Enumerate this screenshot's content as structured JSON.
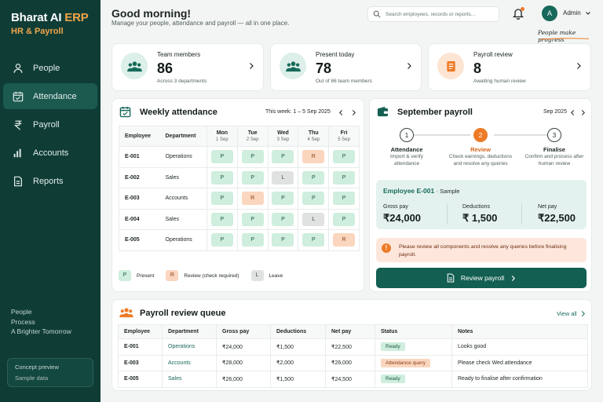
{
  "brand": {
    "title": "Bharat AI",
    "title_accent": "ERP",
    "subtitle": "HR & Payroll"
  },
  "nav": [
    {
      "label": "People",
      "icon": "person-icon",
      "active": false
    },
    {
      "label": "Attendance",
      "icon": "calendar-icon",
      "active": true
    },
    {
      "label": "Payroll",
      "icon": "rupee-icon",
      "active": false
    },
    {
      "label": "Accounts",
      "icon": "bar-chart-icon",
      "active": false
    },
    {
      "label": "Reports",
      "icon": "document-icon",
      "active": false
    }
  ],
  "tagline": [
    "People",
    "Process",
    "A Brighter Tomorrow"
  ],
  "concept": {
    "title": "Concept preview",
    "sub": "Sample data"
  },
  "header": {
    "greeting": "Good morning!",
    "subtitle": "Manage your people, attendance and payroll — all in one place.",
    "search_placeholder": "Search employees, records or reports...",
    "avatar_initial": "A",
    "user": "Admin",
    "slogan": "People make progress"
  },
  "stats": [
    {
      "label": "Team members",
      "value": "86",
      "sub": "Across 3 departments",
      "icon": "team-icon"
    },
    {
      "label": "Present today",
      "value": "78",
      "sub": "Out of 86 team members",
      "icon": "team-icon"
    },
    {
      "label": "Payroll review",
      "value": "8",
      "sub": "Awaiting human review",
      "icon": "document-icon"
    }
  ],
  "attendance": {
    "title": "Weekly attendance",
    "week": "This week: 1 – 5 Sep 2025",
    "col_employee": "Employee",
    "col_department": "Department",
    "days": [
      {
        "d": "Mon",
        "date": "1 Sep"
      },
      {
        "d": "Tue",
        "date": "2 Sep"
      },
      {
        "d": "Wed",
        "date": "3 Sep"
      },
      {
        "d": "Thu",
        "date": "4 Sep"
      },
      {
        "d": "Fri",
        "date": "5 Sep"
      }
    ],
    "rows": [
      {
        "emp": "E-001",
        "dept": "Operations",
        "marks": [
          "P",
          "P",
          "P",
          "R",
          "P"
        ]
      },
      {
        "emp": "E-002",
        "dept": "Sales",
        "marks": [
          "P",
          "P",
          "L",
          "P",
          "P"
        ]
      },
      {
        "emp": "E-003",
        "dept": "Accounts",
        "marks": [
          "P",
          "R",
          "P",
          "P",
          "P"
        ]
      },
      {
        "emp": "E-004",
        "dept": "Sales",
        "marks": [
          "P",
          "P",
          "P",
          "L",
          "P"
        ]
      },
      {
        "emp": "E-005",
        "dept": "Operations",
        "marks": [
          "P",
          "P",
          "P",
          "P",
          "R"
        ]
      }
    ],
    "legend": [
      {
        "code": "P",
        "label": "Present"
      },
      {
        "code": "R",
        "label": "Review (check required)"
      },
      {
        "code": "L",
        "label": "Leave"
      }
    ]
  },
  "payroll": {
    "title": "September payroll",
    "month": "Sep 2025",
    "steps": [
      {
        "n": "1",
        "title": "Attendance",
        "desc": "Import & verify attendance",
        "current": false
      },
      {
        "n": "2",
        "title": "Review",
        "desc": "Check earnings, deductions and resolve any queries",
        "current": true
      },
      {
        "n": "3",
        "title": "Finalise",
        "desc": "Confirm and process after human review",
        "current": false
      }
    ],
    "employee": "Employee E-001",
    "employee_tag": "· Sample",
    "gross_label": "Gross pay",
    "gross": "₹24,000",
    "ded_label": "Deductions",
    "ded": "₹ 1,500",
    "net_label": "Net pay",
    "net": "₹22,500",
    "warning": "Please review all components and resolve any queries before finalising payroll.",
    "button": "Review payroll"
  },
  "queue": {
    "title": "Payroll review queue",
    "view_all": "View all",
    "headers": [
      "Employee",
      "Department",
      "Gross pay",
      "Deductions",
      "Net pay",
      "Status",
      "Notes"
    ],
    "rows": [
      {
        "emp": "E-001",
        "dept": "Operations",
        "gross": "₹24,000",
        "ded": "₹1,500",
        "net": "₹22,500",
        "status": "Ready",
        "status_kind": "ok",
        "note": "Looks good"
      },
      {
        "emp": "E-003",
        "dept": "Accounts",
        "gross": "₹28,000",
        "ded": "₹2,000",
        "net": "₹26,000",
        "status": "Attendance query",
        "status_kind": "q",
        "note": "Please check Wed attendance"
      },
      {
        "emp": "E-005",
        "dept": "Sales",
        "gross": "₹26,000",
        "ded": "₹1,500",
        "net": "₹24,500",
        "status": "Ready",
        "status_kind": "ok",
        "note": "Ready to finalise after confirmation"
      }
    ]
  },
  "colors": {
    "sidebar": "#0f3d36",
    "accent": "#f1a54a",
    "primary": "#135f52",
    "orange": "#ee7b27"
  }
}
